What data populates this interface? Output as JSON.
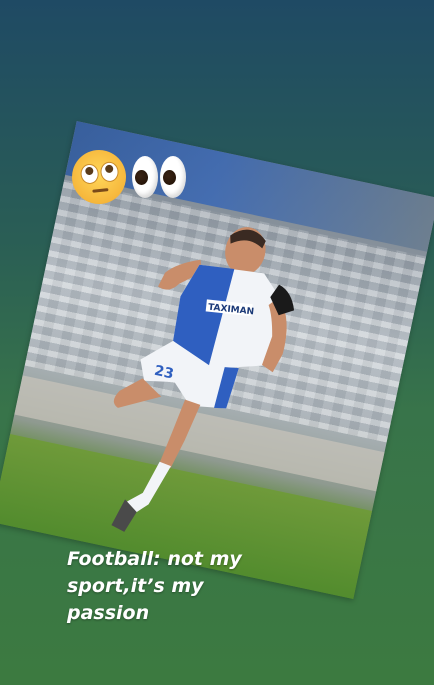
{
  "story": {
    "caption_line1": "Football: not my",
    "caption_line2": "sport,it’s my",
    "caption_line3": "passion",
    "stickers": [
      "face-with-rolling-eyes-emoji",
      "eyes-emoji"
    ],
    "photo": {
      "shirt_text": "TAXIMAN",
      "shirt_number": "23"
    }
  },
  "colors": {
    "background_top": "#1f4a64",
    "background_bottom": "#3c7a40",
    "caption": "#ffffff",
    "kit_blue": "#2f5fc0",
    "kit_white": "#f2f4f8"
  }
}
